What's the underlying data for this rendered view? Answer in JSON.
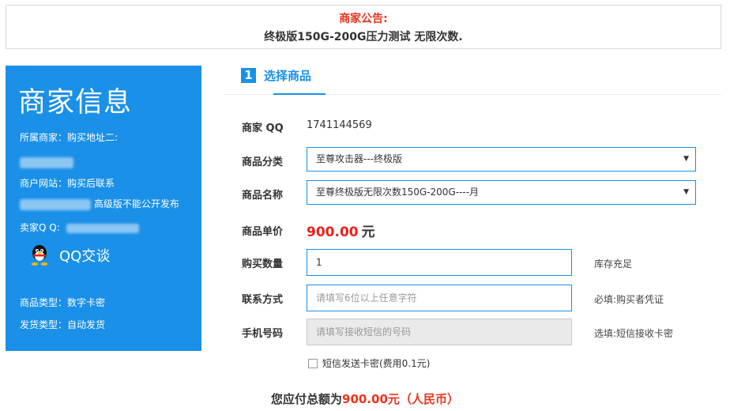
{
  "notice": {
    "title": "商家公告:",
    "text": "终极版150G-200G压力测试 无限次数."
  },
  "merchant": {
    "title": "商家信息",
    "merchant_label": "所属商家：购买地址二:",
    "website_label": "商户网站：购买后联系",
    "website_note": "高级版不能公开发布",
    "seller_qq_label": "卖家Q Q:",
    "qq_chat_label": "QQ交谈",
    "product_type": "商品类型：数字卡密",
    "delivery_type": "发货类型：自动发货"
  },
  "section": {
    "number": "1",
    "title": "选择商品"
  },
  "form": {
    "merchant_qq": {
      "label": "商家 QQ",
      "value": "1741144569"
    },
    "category": {
      "label": "商品分类",
      "selected": "至尊攻击器---终极版"
    },
    "product_name": {
      "label": "商品名称",
      "selected": "至尊终极版无限次数150G-200G----月"
    },
    "unit_price": {
      "label": "商品单价",
      "value": "900.00",
      "unit": "元"
    },
    "quantity": {
      "label": "购买数量",
      "value": "1",
      "note": "库存充足"
    },
    "contact": {
      "label": "联系方式",
      "placeholder": "请填写6位以上任意字符",
      "note": "必填:购买者凭证"
    },
    "phone": {
      "label": "手机号码",
      "placeholder": "请填写接收短信的号码",
      "note": "选填:短信接收卡密"
    },
    "sms_option": "短信发送卡密(费用0.1元)"
  },
  "total": {
    "prefix": "您应付总额为",
    "amount": "900.00元",
    "currency": "（人民币）"
  },
  "colors": {
    "accent": "#1a90e8",
    "price_red": "#e8211c",
    "notice_red": "#e8341c"
  }
}
